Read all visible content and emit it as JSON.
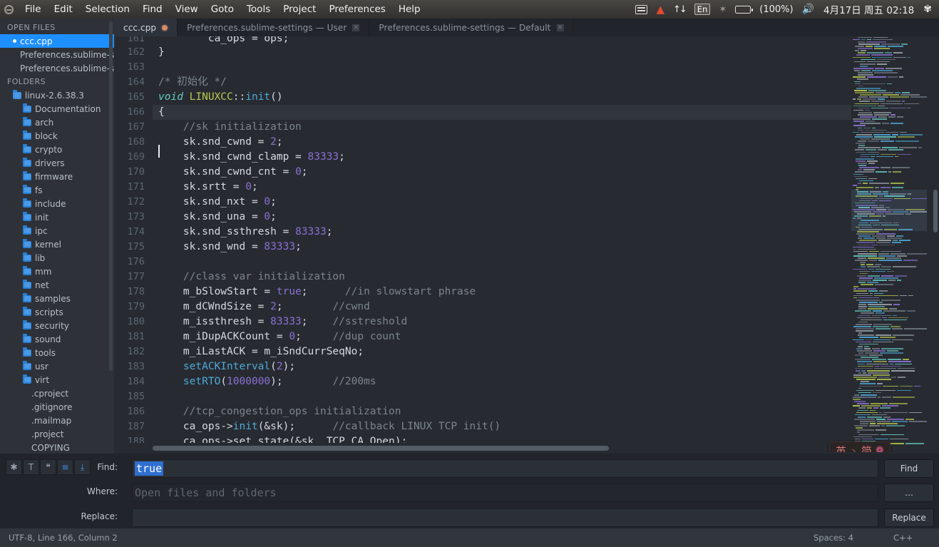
{
  "topbar": {
    "logo": "ubuntu-logo",
    "menus": [
      "File",
      "Edit",
      "Selection",
      "Find",
      "View",
      "Goto",
      "Tools",
      "Project",
      "Preferences",
      "Help"
    ],
    "tray": {
      "keyboard_icon": "keyboard-icon",
      "warning_icon": "warning-triangle-icon",
      "network_icon": "network-updown-icon",
      "network_glyph": "↑↓",
      "input_method": "En",
      "bluetooth_icon": "bluetooth-icon",
      "bluetooth_glyph": "✶",
      "battery_icon": "battery-icon",
      "battery_label": "(100%)",
      "volume_icon": "volume-icon",
      "volume_glyph": "🔊",
      "datetime": "4月17日 周五 02:18",
      "settings_icon": "gear-icon",
      "settings_glyph": "✾"
    }
  },
  "tabs": [
    {
      "label": "ccc.cpp",
      "active": true,
      "dirty": true,
      "close": ""
    },
    {
      "label": "Preferences.sublime-settings — User",
      "active": false,
      "dirty": false,
      "close": "✕"
    },
    {
      "label": "Preferences.sublime-settings — Default",
      "active": false,
      "dirty": false,
      "close": "✕"
    }
  ],
  "sidebar": {
    "open_files_header": "OPEN FILES",
    "open_files": [
      {
        "label": "ccc.cpp",
        "selected": true
      },
      {
        "label": "Preferences.sublime-sett",
        "selected": false
      },
      {
        "label": "Preferences.sublime-sett",
        "selected": false
      }
    ],
    "folders_header": "FOLDERS",
    "root": "linux-2.6.38.3",
    "folders": [
      "Documentation",
      "arch",
      "block",
      "crypto",
      "drivers",
      "firmware",
      "fs",
      "include",
      "init",
      "ipc",
      "kernel",
      "lib",
      "mm",
      "net",
      "samples",
      "scripts",
      "security",
      "sound",
      "tools",
      "usr",
      "virt"
    ],
    "files": [
      ".cproject",
      ".gitignore",
      ".mailmap",
      ".project",
      "COPYING"
    ]
  },
  "editor": {
    "first_line": 161,
    "lines": [
      {
        "n": 161,
        "clipped": true,
        "tokens": [
          {
            "t": "        ca_ops = ops;",
            "c": "tk-op"
          }
        ]
      },
      {
        "n": 162,
        "tokens": [
          {
            "t": "}",
            "c": "tk-op"
          }
        ]
      },
      {
        "n": 163,
        "tokens": [
          {
            "t": "",
            "c": "tk-op"
          }
        ]
      },
      {
        "n": 164,
        "tokens": [
          {
            "t": "/* 初始化 */",
            "c": "tk-cmt"
          }
        ]
      },
      {
        "n": 165,
        "tokens": [
          {
            "t": "void",
            "c": "tk-kw"
          },
          {
            "t": " ",
            "c": "tk-op"
          },
          {
            "t": "LINUXCC",
            "c": "tk-cls"
          },
          {
            "t": "::",
            "c": "tk-op"
          },
          {
            "t": "init",
            "c": "tk-fn"
          },
          {
            "t": "()",
            "c": "tk-op"
          }
        ]
      },
      {
        "n": 166,
        "active": true,
        "tokens": [
          {
            "t": "{",
            "c": "tk-op"
          }
        ]
      },
      {
        "n": 167,
        "tokens": [
          {
            "t": "    //sk initialization",
            "c": "tk-cmt"
          }
        ]
      },
      {
        "n": 168,
        "tokens": [
          {
            "t": "    sk.snd_cwnd = ",
            "c": "tk-op"
          },
          {
            "t": "2",
            "c": "tk-num"
          },
          {
            "t": ";",
            "c": "tk-op"
          }
        ]
      },
      {
        "n": 169,
        "tokens": [
          {
            "t": "    sk.snd_cwnd_clamp = ",
            "c": "tk-op"
          },
          {
            "t": "83333",
            "c": "tk-num"
          },
          {
            "t": ";",
            "c": "tk-op"
          }
        ]
      },
      {
        "n": 170,
        "tokens": [
          {
            "t": "    sk.snd_cwnd_cnt = ",
            "c": "tk-op"
          },
          {
            "t": "0",
            "c": "tk-num"
          },
          {
            "t": ";",
            "c": "tk-op"
          }
        ]
      },
      {
        "n": 171,
        "tokens": [
          {
            "t": "    sk.srtt = ",
            "c": "tk-op"
          },
          {
            "t": "0",
            "c": "tk-num"
          },
          {
            "t": ";",
            "c": "tk-op"
          }
        ]
      },
      {
        "n": 172,
        "tokens": [
          {
            "t": "    sk.snd_nxt = ",
            "c": "tk-op"
          },
          {
            "t": "0",
            "c": "tk-num"
          },
          {
            "t": ";",
            "c": "tk-op"
          }
        ]
      },
      {
        "n": 173,
        "tokens": [
          {
            "t": "    sk.snd_una = ",
            "c": "tk-op"
          },
          {
            "t": "0",
            "c": "tk-num"
          },
          {
            "t": ";",
            "c": "tk-op"
          }
        ]
      },
      {
        "n": 174,
        "tokens": [
          {
            "t": "    sk.snd_ssthresh = ",
            "c": "tk-op"
          },
          {
            "t": "83333",
            "c": "tk-num"
          },
          {
            "t": ";",
            "c": "tk-op"
          }
        ]
      },
      {
        "n": 175,
        "tokens": [
          {
            "t": "    sk.snd_wnd = ",
            "c": "tk-op"
          },
          {
            "t": "83333",
            "c": "tk-num"
          },
          {
            "t": ";",
            "c": "tk-op"
          }
        ]
      },
      {
        "n": 176,
        "tokens": [
          {
            "t": "",
            "c": "tk-op"
          }
        ]
      },
      {
        "n": 177,
        "tokens": [
          {
            "t": "    //class var initialization",
            "c": "tk-cmt"
          }
        ]
      },
      {
        "n": 178,
        "tokens": [
          {
            "t": "    m_bSlowStart = ",
            "c": "tk-op"
          },
          {
            "t": "true",
            "c": "tk-num"
          },
          {
            "t": ";      ",
            "c": "tk-op"
          },
          {
            "t": "//in slowstart phrase",
            "c": "tk-cmt"
          }
        ]
      },
      {
        "n": 179,
        "tokens": [
          {
            "t": "    m_dCWndSize = ",
            "c": "tk-op"
          },
          {
            "t": "2",
            "c": "tk-num"
          },
          {
            "t": ";        ",
            "c": "tk-op"
          },
          {
            "t": "//cwnd",
            "c": "tk-cmt"
          }
        ]
      },
      {
        "n": 180,
        "tokens": [
          {
            "t": "    m_issthresh = ",
            "c": "tk-op"
          },
          {
            "t": "83333",
            "c": "tk-num"
          },
          {
            "t": ";    ",
            "c": "tk-op"
          },
          {
            "t": "//sstreshold",
            "c": "tk-cmt"
          }
        ]
      },
      {
        "n": 181,
        "tokens": [
          {
            "t": "    m_iDupACKCount = ",
            "c": "tk-op"
          },
          {
            "t": "0",
            "c": "tk-num"
          },
          {
            "t": ";     ",
            "c": "tk-op"
          },
          {
            "t": "//dup count",
            "c": "tk-cmt"
          }
        ]
      },
      {
        "n": 182,
        "tokens": [
          {
            "t": "    m_iLastACK = m_iSndCurrSeqNo;",
            "c": "tk-op"
          }
        ]
      },
      {
        "n": 183,
        "tokens": [
          {
            "t": "    ",
            "c": "tk-op"
          },
          {
            "t": "setACKInterval",
            "c": "tk-fn"
          },
          {
            "t": "(",
            "c": "tk-op"
          },
          {
            "t": "2",
            "c": "tk-num"
          },
          {
            "t": ");",
            "c": "tk-op"
          }
        ]
      },
      {
        "n": 184,
        "tokens": [
          {
            "t": "    ",
            "c": "tk-op"
          },
          {
            "t": "setRTO",
            "c": "tk-fn"
          },
          {
            "t": "(",
            "c": "tk-op"
          },
          {
            "t": "1000000",
            "c": "tk-num"
          },
          {
            "t": ");",
            "c": "tk-op"
          },
          {
            "t": "        //200ms",
            "c": "tk-cmt"
          }
        ]
      },
      {
        "n": 185,
        "tokens": [
          {
            "t": "",
            "c": "tk-op"
          }
        ]
      },
      {
        "n": 186,
        "tokens": [
          {
            "t": "    //tcp_congestion_ops initialization",
            "c": "tk-cmt"
          }
        ]
      },
      {
        "n": 187,
        "tokens": [
          {
            "t": "    ca_ops->",
            "c": "tk-op"
          },
          {
            "t": "init",
            "c": "tk-fn"
          },
          {
            "t": "(&sk);",
            "c": "tk-op"
          },
          {
            "t": "      //callback LINUX TCP init()",
            "c": "tk-cmt"
          }
        ]
      },
      {
        "n": 188,
        "clipped": true,
        "tokens": [
          {
            "t": "    ca_ops->set_state(&sk, TCP_CA_Open);",
            "c": "tk-op"
          }
        ]
      }
    ]
  },
  "ime": {
    "mode": "英",
    "separator": "丶",
    "script": "简",
    "gear_icon": "gear-icon",
    "gear_glyph": "❁"
  },
  "find_panel": {
    "tools": [
      {
        "name": "regex-toggle",
        "glyph": "✱",
        "on": false
      },
      {
        "name": "case-sensitive-toggle",
        "glyph": "T",
        "on": false
      },
      {
        "name": "whole-word-toggle",
        "glyph": "❝",
        "on": false
      },
      {
        "name": "show-context-toggle",
        "glyph": "≡",
        "on": true
      },
      {
        "name": "use-buffer-toggle",
        "glyph": "⤓",
        "on": true
      }
    ],
    "find_label": "Find:",
    "find_value": "true",
    "where_label": "Where:",
    "where_placeholder": "Open files and folders",
    "where_value": "",
    "replace_label": "Replace:",
    "replace_value": "",
    "find_button": "Find",
    "options_button": "…",
    "replace_button": "Replace"
  },
  "statusbar": {
    "left": "UTF-8, Line 166, Column 2",
    "spaces": "Spaces: 4",
    "syntax": "C++"
  },
  "colors": {
    "accent_blue": "#1e8fff",
    "editor_bg": "#272b31",
    "sidebar_bg": "#2e3238",
    "panel_bg": "#21252b",
    "comment": "#7d848c",
    "number": "#8b6fd4",
    "keyword": "#66c9c2",
    "class": "#b9c94e",
    "function": "#4fa8d8"
  }
}
